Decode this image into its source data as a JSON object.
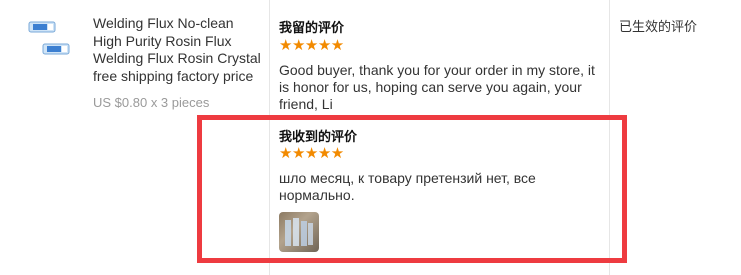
{
  "product": {
    "title": "Welding Flux No-clean High Purity Rosin Flux Welding Flux Rosin Crystal free shipping factory price",
    "price": "US $0.80 x 3 pieces"
  },
  "left_feedback": {
    "heading": "我留的评价",
    "stars": "★★★★★",
    "rating": 5,
    "text": "Good buyer, thank you for your order in my store, it is honor for us, hoping can serve you again, your friend, Li"
  },
  "received_feedback": {
    "heading": "我收到的评价",
    "stars": "★★★★★",
    "rating": 5,
    "text": "шло месяц, к товару претензий нет, все нормально."
  },
  "status": {
    "label": "已生效的评价"
  },
  "colors": {
    "star": "#f28a00",
    "highlight_border": "#ee3b40"
  }
}
